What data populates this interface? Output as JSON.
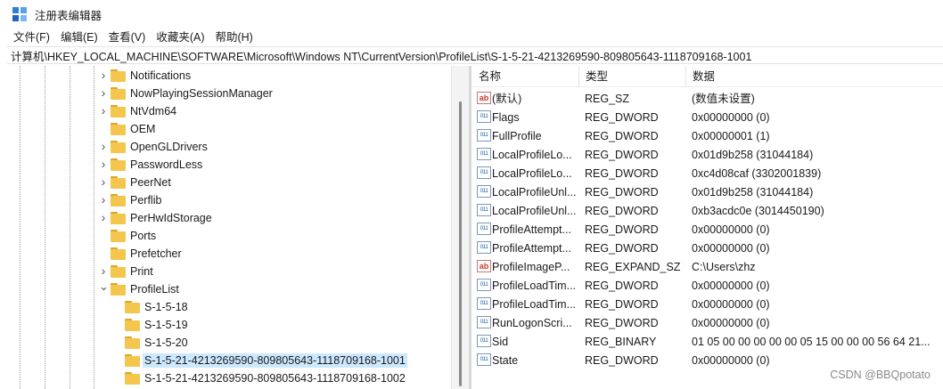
{
  "window": {
    "title": "注册表编辑器",
    "icon": "registry-editor-icon",
    "icon_colors": [
      "#2f7fd6",
      "#5aa0e8",
      "#1e66b8",
      "#7bb6f0"
    ]
  },
  "menu": [
    "文件(F)",
    "编辑(E)",
    "查看(V)",
    "收藏夹(A)",
    "帮助(H)"
  ],
  "address": "计算机\\HKEY_LOCAL_MACHINE\\SOFTWARE\\Microsoft\\Windows NT\\CurrentVersion\\ProfileList\\S-1-5-21-4213269590-809805643-1118709168-1001",
  "tree": {
    "items": [
      {
        "label": "Notifications",
        "expander": "collapsed",
        "selected": false
      },
      {
        "label": "NowPlayingSessionManager",
        "expander": "collapsed",
        "selected": false
      },
      {
        "label": "NtVdm64",
        "expander": "collapsed",
        "selected": false
      },
      {
        "label": "OEM",
        "expander": "none",
        "selected": false
      },
      {
        "label": "OpenGLDrivers",
        "expander": "collapsed",
        "selected": false
      },
      {
        "label": "PasswordLess",
        "expander": "collapsed",
        "selected": false
      },
      {
        "label": "PeerNet",
        "expander": "collapsed",
        "selected": false
      },
      {
        "label": "Perflib",
        "expander": "collapsed",
        "selected": false
      },
      {
        "label": "PerHwIdStorage",
        "expander": "collapsed",
        "selected": false
      },
      {
        "label": "Ports",
        "expander": "none",
        "selected": false
      },
      {
        "label": "Prefetcher",
        "expander": "none",
        "selected": false
      },
      {
        "label": "Print",
        "expander": "collapsed",
        "selected": false
      },
      {
        "label": "ProfileList",
        "expander": "expanded",
        "selected": false
      },
      {
        "label": "S-1-5-18",
        "expander": "none",
        "selected": false
      },
      {
        "label": "S-1-5-19",
        "expander": "none",
        "selected": false
      },
      {
        "label": "S-1-5-20",
        "expander": "none",
        "selected": false
      },
      {
        "label": "S-1-5-21-4213269590-809805643-1118709168-1001",
        "expander": "none",
        "selected": true
      },
      {
        "label": "S-1-5-21-4213269590-809805643-1118709168-1002",
        "expander": "none",
        "selected": false
      }
    ]
  },
  "list": {
    "headers": {
      "name": "名称",
      "type": "类型",
      "data": "数据"
    },
    "rows": [
      {
        "icon": "string-value-icon",
        "name": "(默认)",
        "type": "REG_SZ",
        "data": "(数值未设置)"
      },
      {
        "icon": "binary-value-icon",
        "name": "Flags",
        "type": "REG_DWORD",
        "data": "0x00000000 (0)"
      },
      {
        "icon": "binary-value-icon",
        "name": "FullProfile",
        "type": "REG_DWORD",
        "data": "0x00000001 (1)"
      },
      {
        "icon": "binary-value-icon",
        "name": "LocalProfileLo...",
        "type": "REG_DWORD",
        "data": "0x01d9b258 (31044184)"
      },
      {
        "icon": "binary-value-icon",
        "name": "LocalProfileLo...",
        "type": "REG_DWORD",
        "data": "0xc4d08caf (3302001839)"
      },
      {
        "icon": "binary-value-icon",
        "name": "LocalProfileUnl...",
        "type": "REG_DWORD",
        "data": "0x01d9b258 (31044184)"
      },
      {
        "icon": "binary-value-icon",
        "name": "LocalProfileUnl...",
        "type": "REG_DWORD",
        "data": "0xb3acdc0e (3014450190)"
      },
      {
        "icon": "binary-value-icon",
        "name": "ProfileAttempt...",
        "type": "REG_DWORD",
        "data": "0x00000000 (0)"
      },
      {
        "icon": "binary-value-icon",
        "name": "ProfileAttempt...",
        "type": "REG_DWORD",
        "data": "0x00000000 (0)"
      },
      {
        "icon": "string-value-icon",
        "name": "ProfileImageP...",
        "type": "REG_EXPAND_SZ",
        "data": "C:\\Users\\zhz"
      },
      {
        "icon": "binary-value-icon",
        "name": "ProfileLoadTim...",
        "type": "REG_DWORD",
        "data": "0x00000000 (0)"
      },
      {
        "icon": "binary-value-icon",
        "name": "ProfileLoadTim...",
        "type": "REG_DWORD",
        "data": "0x00000000 (0)"
      },
      {
        "icon": "binary-value-icon",
        "name": "RunLogonScri...",
        "type": "REG_DWORD",
        "data": "0x00000000 (0)"
      },
      {
        "icon": "binary-value-icon",
        "name": "Sid",
        "type": "REG_BINARY",
        "data": "01 05 00 00 00 00 00 05 15 00 00 00 56 64 21..."
      },
      {
        "icon": "binary-value-icon",
        "name": "State",
        "type": "REG_DWORD",
        "data": "0x00000000 (0)"
      }
    ]
  },
  "colors": {
    "selection": "#cce8ff",
    "folder": "#f4c64e"
  },
  "watermark": "CSDN @BBQpotato"
}
